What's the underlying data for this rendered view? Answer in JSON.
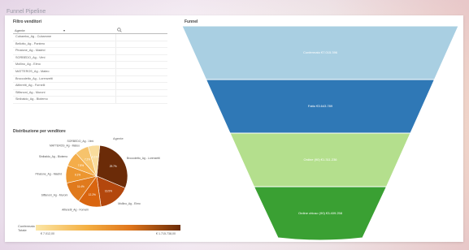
{
  "app": {
    "title": "Funnel Pipeline"
  },
  "filter": {
    "title": "Filtro venditori",
    "column_header": "Agente",
    "items": [
      "Cubamba_Ag - Cubamme",
      "Bellotto_Ag - Pantero",
      "Pinalone_Ag - Madrid",
      "SORBEDO_Ag - Vimi",
      "Mollino_Ag - Elmo",
      "MATTEROS_Ag - Mateo",
      "Broccoletto_Ag - Lorenzetti",
      "Alfieretti_Ag - Fornelli",
      "Siffanoni_Ag - Muroni",
      "Sinibaldo_Ag - Biotemo"
    ]
  },
  "pie": {
    "title": "Distribuzione per venditore",
    "header_label": "Agente",
    "slices": [
      {
        "label": "Broccoletto_Ag - Lorenzetti",
        "value": "29.7%",
        "share": 29.7,
        "color": "#6b2b08"
      },
      {
        "label": "Mollino_Ag - Elmo",
        "value": "16.5%",
        "share": 16.5,
        "color": "#b3470d"
      },
      {
        "label": "Alfieretti_Ag - Fornelli",
        "value": "12.2%",
        "share": 12.2,
        "color": "#d9650f"
      },
      {
        "label": "Siffanoni_Ag - Muroni",
        "value": "11.4%",
        "share": 11.4,
        "color": "#e07a1d"
      },
      {
        "label": "Pinalone_Ag - Madrid",
        "value": "9.1%",
        "share": 9.1,
        "color": "#ec9630"
      },
      {
        "label": "Sinibaldo_Ag - Biotemo",
        "value": "7.8%",
        "share": 7.8,
        "color": "#f4ad4a"
      },
      {
        "label": "MATTEROS_Ag - Mateo",
        "value": "7.2%",
        "share": 7.2,
        "color": "#f6c36c"
      },
      {
        "label": "SORBEDO_Ag - Vimi",
        "value": "6.1%",
        "share": 6.1,
        "color": "#f9dc9c"
      }
    ]
  },
  "legend": {
    "label_line1": "Confermato",
    "label_line2": "Totale",
    "min": "€ 7.012,00",
    "max": "€ 1.715.738,00",
    "gradient": [
      "#fbe6a6",
      "#f4b043",
      "#e0761c",
      "#6b2b08"
    ]
  },
  "funnel": {
    "title": "Funnel",
    "stages": [
      {
        "label": "Confermato €7.015.396",
        "color": "#a9cfe2"
      },
      {
        "label": "Fatto €3.643.789",
        "color": "#2f78b6"
      },
      {
        "label": "Ordine (90) €1.311.236",
        "color": "#b4df8d"
      },
      {
        "label": "Ordine chiuso (90) €3.409.258",
        "color": "#3aa033"
      }
    ]
  }
}
